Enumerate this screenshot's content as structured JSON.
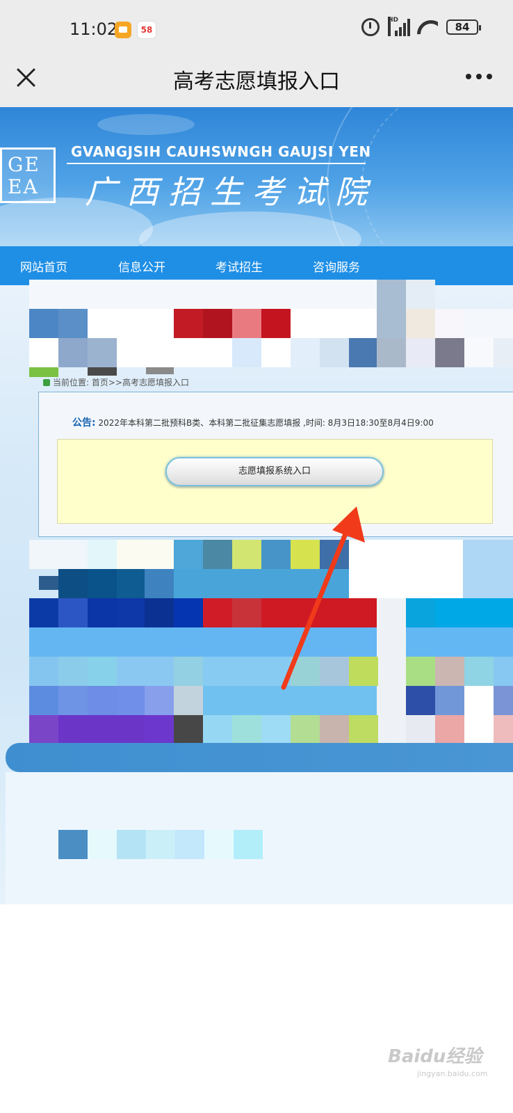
{
  "status_bar": {
    "time": "11:02",
    "app_badge": "58",
    "network_label": "HD",
    "battery": "84"
  },
  "title_bar": {
    "title": "高考志愿填报入口"
  },
  "site_header": {
    "english_name": "GVANGJSIH CAUHSWNGH GAUJSI YEN",
    "chinese_name": "广西招生考试院",
    "logo_text": "GEEA"
  },
  "nav": {
    "items": [
      "网站首页",
      "信息公开",
      "考试招生",
      "咨询服务"
    ]
  },
  "breadcrumb": {
    "text": "当前位置: 首页>>高考志愿填报入口"
  },
  "notice": {
    "label": "公告:",
    "text": " 2022年本科第二批预科B类、本科第二批征集志愿填报 ,时间:  8月3日18:30至8月4日9:00"
  },
  "entry": {
    "button_label": "志愿填报系统入口"
  },
  "annotation": {
    "arrow_color": "#f03a1a"
  },
  "watermark": {
    "text": "Baidu经验",
    "sub": "jingyan.baidu.com"
  },
  "colors": {
    "nav_blue": "#1f8fe6",
    "notice_label": "#1561b0",
    "yellow_panel": "#ffffcc"
  }
}
